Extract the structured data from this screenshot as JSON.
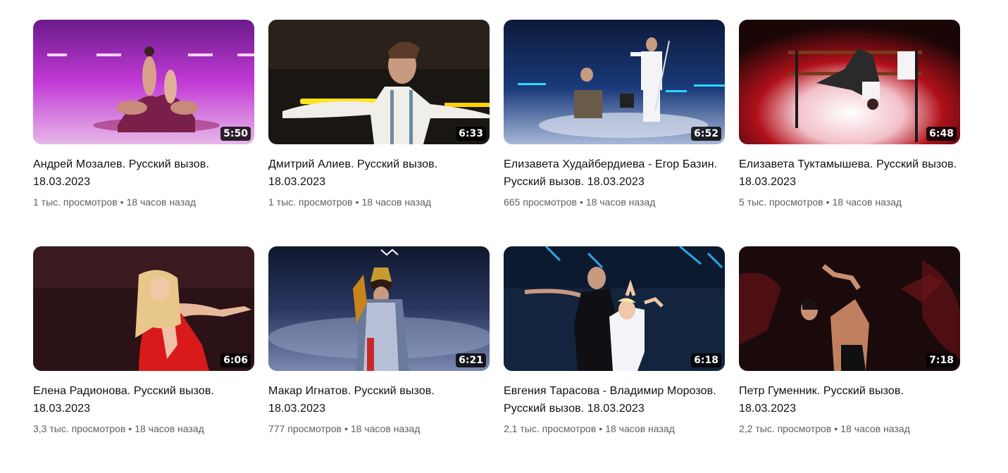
{
  "videos": [
    {
      "title": "Андрей Мозалев. Русский вызов. 18.03.2023",
      "duration": "5:50",
      "views": "1 тыс. просмотров",
      "age": "18 часов назад"
    },
    {
      "title": "Дмитрий Алиев. Русский вызов. 18.03.2023",
      "duration": "6:33",
      "views": "1 тыс. просмотров",
      "age": "18 часов назад"
    },
    {
      "title": "Елизавета Худайбердиева - Егор Базин. Русский вызов. 18.03.2023",
      "duration": "6:52",
      "views": "665 просмотров",
      "age": "18 часов назад"
    },
    {
      "title": "Елизавета Туктамышева. Русский вызов. 18.03.2023",
      "duration": "6:48",
      "views": "5 тыс. просмотров",
      "age": "18 часов назад"
    },
    {
      "title": "Елена Радионова. Русский вызов. 18.03.2023",
      "duration": "6:06",
      "views": "3,3 тыс. просмотров",
      "age": "18 часов назад"
    },
    {
      "title": "Макар Игнатов. Русский вызов. 18.03.2023",
      "duration": "6:21",
      "views": "777 просмотров",
      "age": "18 часов назад"
    },
    {
      "title": "Евгения Тарасова - Владимир Морозов. Русский вызов. 18.03.2023",
      "duration": "6:18",
      "views": "2,1 тыс. просмотров",
      "age": "18 часов назад"
    },
    {
      "title": "Петр Гуменник. Русский вызов. 18.03.2023",
      "duration": "7:18",
      "views": "2,2 тыс. просмотров",
      "age": "18 часов назад"
    }
  ],
  "separator": "•"
}
